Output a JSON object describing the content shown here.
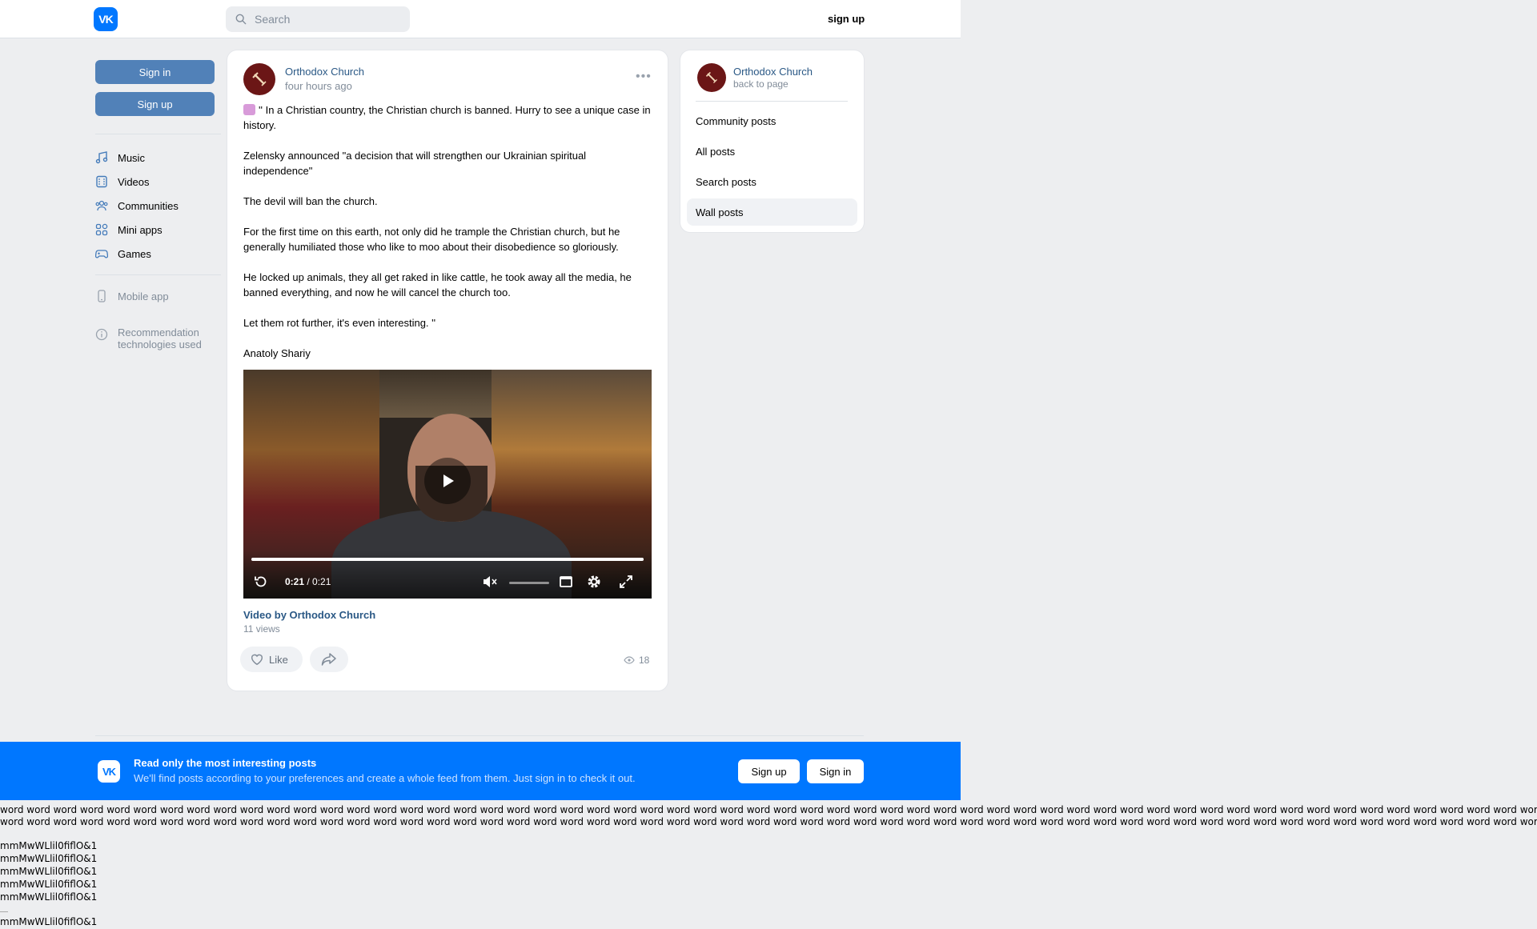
{
  "header": {
    "logo_text": "VK",
    "search_placeholder": "Search",
    "signup_label": "sign up"
  },
  "left_nav": {
    "signin_label": "Sign in",
    "signup_label": "Sign up",
    "items": [
      {
        "label": "Music",
        "icon": "music-icon"
      },
      {
        "label": "Videos",
        "icon": "videos-icon"
      },
      {
        "label": "Communities",
        "icon": "communities-icon"
      },
      {
        "label": "Mini apps",
        "icon": "mini-apps-icon"
      },
      {
        "label": "Games",
        "icon": "games-icon"
      }
    ],
    "mobile_app_label": "Mobile app",
    "recommendation_line1": "Recommendation",
    "recommendation_line2": "technologies used"
  },
  "post": {
    "author": "Orthodox Church",
    "time": "four hours ago",
    "more_label": "•••",
    "paragraphs": [
      "'' In a Christian country, the Christian church is banned. Hurry to see a unique case in history.",
      "Zelensky announced \"a decision that will strengthen our Ukrainian spiritual independence\"",
      "The devil will ban the church.",
      "For the first time on this earth, not only did he trample the Christian church, but he generally humiliated those who like to moo about their disobedience so gloriously.",
      "He locked up animals, they all get raked in like cattle, he took away all the media, he banned everything, and now he will cancel the church too.",
      "Let them rot further, it's even interesting. ''",
      "Anatoly Shariy"
    ],
    "video": {
      "current_time": "0:21",
      "separator": " / ",
      "duration": "0:21",
      "progress_fraction": 1.0,
      "title": "Video by Orthodox Church",
      "views": "11 views"
    },
    "like_label": "Like",
    "view_count": "18"
  },
  "right_card": {
    "name": "Orthodox Church",
    "back_label": "back to page",
    "menu": [
      {
        "label": "Community posts",
        "active": false
      },
      {
        "label": "All posts",
        "active": false
      },
      {
        "label": "Search posts",
        "active": false
      },
      {
        "label": "Wall posts",
        "active": true
      }
    ]
  },
  "banner": {
    "logo_text": "VK",
    "title": "Read only the most interesting posts",
    "subtitle": "We'll find posts according to your preferences and create a whole feed from them. Just sign in to check it out.",
    "signup_label": "Sign up",
    "signin_label": "Sign in"
  },
  "debug": {
    "word_line1": "word word word word word word word word word word word word word word word word word word word word word word word word word word word word word word word word word word word word word word word word word word word word word word word word word word word word word word word word word word word word word word word word word word word word word",
    "word_line2": "word word word word word word word word word word word word word word word word word word word word word word word word word word word word word word word word word word word word word word word word word word word word word word word word word word word word word word word word word word word word word word word word word word word word",
    "glyph_lines": [
      "mmMwWLlil0fiflO&1",
      "mmMwWLlil0fiflO&1",
      "mmMwWLlil0fiflO&1",
      "mmMwWLlil0fiflO&1",
      "mmMwWLlil0fiflO&1"
    ],
    "glyph_last": "mmMwWLlil0fiflO&1"
  },
  "colors": {
    "brand": "#0077ff",
    "button_blue": "#5181b8",
    "link": "#2a5885",
    "page_bg": "#edeef0"
  }
}
